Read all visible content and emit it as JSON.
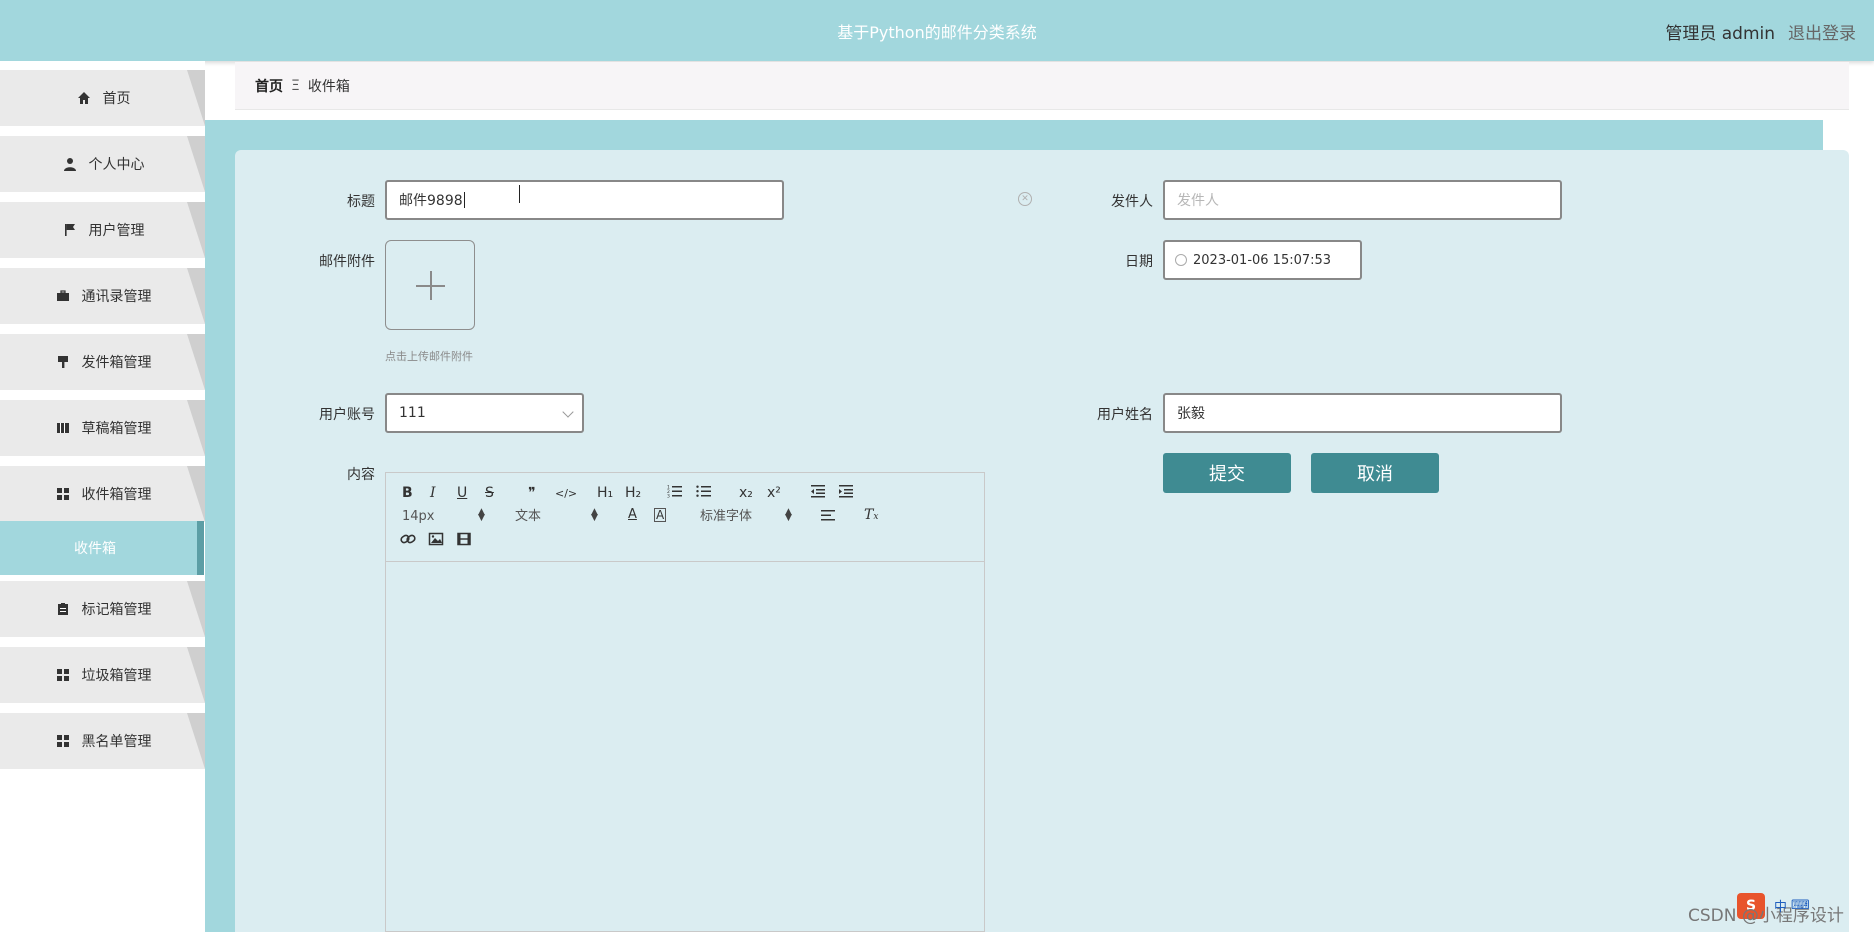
{
  "header": {
    "title": "基于Python的邮件分类系统",
    "user_label": "管理员 admin",
    "logout_label": "退出登录"
  },
  "sidebar": {
    "items": [
      {
        "label": "首页",
        "icon": "home-icon"
      },
      {
        "label": "个人中心",
        "icon": "person-icon"
      },
      {
        "label": "用户管理",
        "icon": "flag-icon"
      },
      {
        "label": "通讯录管理",
        "icon": "briefcase-icon"
      },
      {
        "label": "发件箱管理",
        "icon": "brush-icon"
      },
      {
        "label": "草稿箱管理",
        "icon": "book-icon"
      },
      {
        "label": "收件箱管理",
        "icon": "grid-icon"
      },
      {
        "label": "标记箱管理",
        "icon": "clipboard-icon"
      },
      {
        "label": "垃圾箱管理",
        "icon": "grid-icon"
      },
      {
        "label": "黑名单管理",
        "icon": "grid-icon"
      }
    ],
    "active_sub_item": "收件箱"
  },
  "breadcrumb": {
    "home": "首页",
    "separator": "Ξ",
    "current": "收件箱"
  },
  "form": {
    "title_label": "标题",
    "title_value": "邮件9898",
    "sender_label": "发件人",
    "sender_placeholder": "发件人",
    "attachment_label": "邮件附件",
    "attachment_hint": "点击上传邮件附件",
    "date_label": "日期",
    "date_value": "2023-01-06 15:07:53",
    "account_label": "用户账号",
    "account_value": "111",
    "name_label": "用户姓名",
    "name_value": "张毅",
    "content_label": "内容",
    "submit_label": "提交",
    "cancel_label": "取消"
  },
  "editor": {
    "toolbar_row1": [
      "B",
      "I",
      "U",
      "S",
      "❞",
      "</>",
      "H₁",
      "H₂",
      "ordered-list",
      "bullet-list",
      "x₂",
      "x²",
      "outdent",
      "indent"
    ],
    "font_size": "14px",
    "block_type": "文本",
    "font_family": "标准字体"
  },
  "overlay": {
    "watermark": "CSDN @小程序设计",
    "logo_letter": "S",
    "ime_text": "中"
  }
}
